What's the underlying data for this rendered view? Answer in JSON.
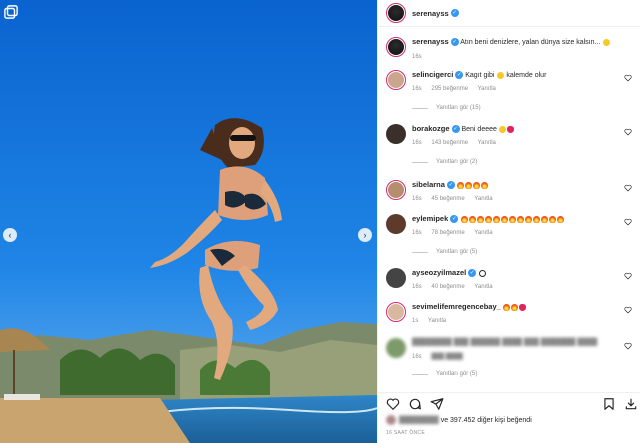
{
  "post": {
    "username": "serenayss",
    "caption": "Atın beni denizlere, yalan dünya size kalsın...",
    "caption_time": "16s"
  },
  "comments": [
    {
      "username": "selincigerci",
      "text_before": "Kagıt gibi",
      "text_after": "kalemde olur",
      "time": "16s",
      "likes": "295 beğenme",
      "reply": "Yanıtla",
      "replies": "Yanıtları gör (15)"
    },
    {
      "username": "borakozge",
      "text_before": "Beni deeee",
      "text_after": "",
      "time": "16s",
      "likes": "143 beğenme",
      "reply": "Yanıtla",
      "replies": "Yanıtları gör (2)"
    },
    {
      "username": "sibelarna",
      "text_before": "",
      "text_after": "",
      "time": "16s",
      "likes": "45 beğenme",
      "reply": "Yanıtla",
      "replies": ""
    },
    {
      "username": "eylemipek",
      "text_before": "",
      "text_after": "",
      "time": "16s",
      "likes": "78 beğenme",
      "reply": "Yanıtla",
      "replies": "Yanıtları gör (5)"
    },
    {
      "username": "ayseozyilmazel",
      "text_before": "",
      "text_after": "",
      "time": "16s",
      "likes": "40 beğenme",
      "reply": "Yanıtla",
      "replies": ""
    },
    {
      "username": "sevimelifemregencebay_",
      "text_before": "",
      "text_after": "",
      "time": "1s",
      "likes": "",
      "reply": "Yanıtla",
      "replies": ""
    },
    {
      "username": "",
      "text_before": "",
      "text_after": "",
      "time": "16s",
      "likes": "",
      "reply": "",
      "replies": "Yanıtları gör (5)"
    }
  ],
  "footer": {
    "likes_text": "ve 397.452 diğer kişi beğendi",
    "time_ago": "16 SAAT ÖNCE"
  },
  "icons": {
    "verified": "verified-icon",
    "heart": "heart-icon",
    "comment": "comment-icon",
    "share": "share-icon",
    "save": "save-icon",
    "download": "download-icon"
  },
  "colors": {
    "accent": "#3897f0",
    "sky": "#0f6fd6",
    "sea": "#1e7fc4",
    "sand": "#c9a46e"
  }
}
